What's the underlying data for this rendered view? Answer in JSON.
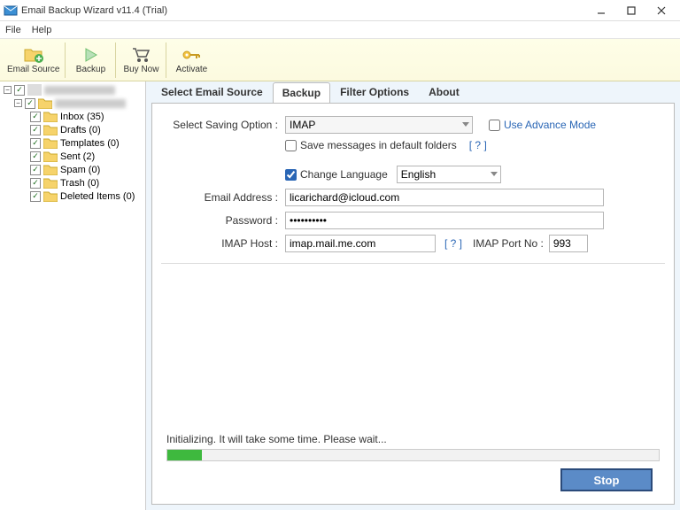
{
  "window": {
    "title": "Email Backup Wizard v11.4 (Trial)"
  },
  "menu": {
    "file": "File",
    "help": "Help"
  },
  "toolbar": {
    "email_source": "Email Source",
    "backup": "Backup",
    "buy_now": "Buy Now",
    "activate": "Activate"
  },
  "sidebar": {
    "account1": "",
    "account2": "",
    "folders": [
      {
        "label": "Inbox (35)"
      },
      {
        "label": "Drafts (0)"
      },
      {
        "label": "Templates (0)"
      },
      {
        "label": "Sent (2)"
      },
      {
        "label": "Spam (0)"
      },
      {
        "label": "Trash (0)"
      },
      {
        "label": "Deleted Items (0)"
      }
    ]
  },
  "tabs": {
    "select": "Select Email Source",
    "backup": "Backup",
    "filter": "Filter Options",
    "about": "About"
  },
  "form": {
    "saving_label": "Select Saving Option :",
    "saving_value": "IMAP",
    "advance_mode": "Use Advance Mode",
    "save_default": "Save messages in default folders",
    "help_token": "[ ? ]",
    "change_lang": "Change Language",
    "lang_value": "English",
    "email_label": "Email Address :",
    "email_value": "licarichard@icloud.com",
    "password_label": "Password :",
    "password_value": "••••••••••",
    "imap_host_label": "IMAP Host :",
    "imap_host_value": "imap.mail.me.com",
    "imap_port_label": "IMAP Port No :",
    "imap_port_value": "993"
  },
  "status": {
    "text": "Initializing. It will take some time. Please wait..."
  },
  "buttons": {
    "stop": "Stop"
  }
}
